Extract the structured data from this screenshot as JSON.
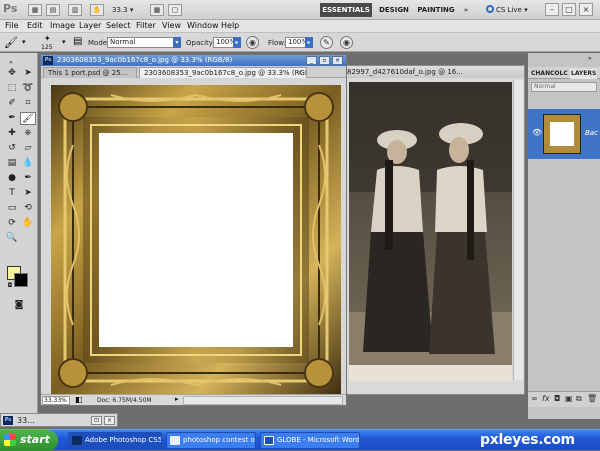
{
  "app": {
    "logo": "Ps",
    "zoom": "33.3",
    "workspaces": [
      "ESSENTIALS",
      "DESIGN",
      "PAINTING"
    ],
    "more": "»",
    "cs_live": "CS Live",
    "window_controls": [
      "–",
      "□",
      "×"
    ]
  },
  "menu": [
    "File",
    "Edit",
    "Image",
    "Layer",
    "Select",
    "Filter",
    "View",
    "Window",
    "Help"
  ],
  "options": {
    "brush_size": "125",
    "mode_label": "Mode:",
    "mode_value": "Normal",
    "opacity_label": "Opacity:",
    "opacity_value": "100%",
    "flow_label": "Flow:",
    "flow_value": "100%"
  },
  "doc1": {
    "title": "2303608353_9ac0b167c8_o.jpg @ 33.3% (RGB/8)",
    "tabs": [
      "This 1 port.psd @ 25...",
      "2303608353_9ac0b167c8_o.jpg @ 33.3% (RGB/8)"
    ],
    "tab_close": "×",
    "zoom": "33.33%",
    "docsize": "Doc: 6.75M/4.50M"
  },
  "doc2": {
    "title": "82997_d427610daf_o.jpg @ 16..."
  },
  "panels": {
    "tabs": [
      "CHAN",
      "COLC",
      "LAYERS"
    ],
    "blend": "Normal",
    "layer_name": "Bac",
    "eye": "👁",
    "footer": [
      "∞",
      "fx",
      "◘",
      "▣",
      "⧉",
      "🗑"
    ]
  },
  "minimized": {
    "title": "33...",
    "buttons": [
      "⊡",
      "×"
    ]
  },
  "taskbar": {
    "start": "start",
    "tasks": [
      "Adobe Photoshop CS5",
      "photoshop contest o...",
      "GLOBE - Microsoft Word"
    ],
    "watermark": "pxleyes.com"
  },
  "colors": {
    "titlebar_blue": "#3f74c2",
    "taskbar_blue": "#2157d6",
    "fg_color": "#f6f29e",
    "bg_color": "#000000"
  }
}
